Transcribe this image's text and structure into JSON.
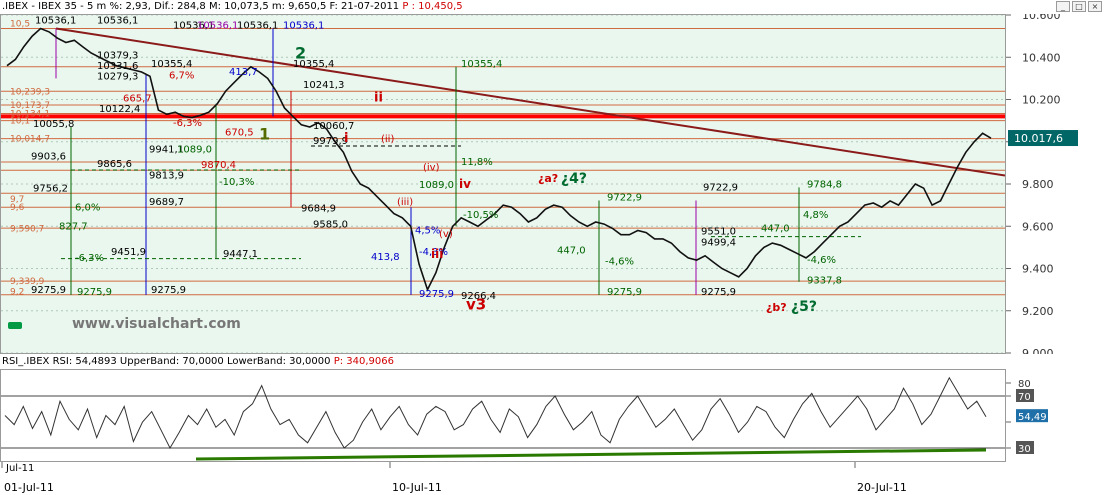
{
  "header": {
    "symbol": ".IBEX - IBEX 35 - 5 m",
    "dif_label": "Dif.,",
    "pct_label": "%: 2,93",
    "dif_value": "Dif.: 284,8",
    "max_label": "M: 10,073,5",
    "min_label": "m: 9,650,5",
    "date_label": "F: 21-07-2011",
    "last_label": "P : 10,450,5"
  },
  "rsi_header": {
    "label": "RSI_.IBEX RSI: 54,4893",
    "upper": "UpperBand: 70,0000",
    "lower": "LowerBand: 30,0000",
    "p_label": "P: 340,9066"
  },
  "watermark": "www.visualchart.com",
  "colors": {
    "panel_bg": "#eaf7ee",
    "price_line": "#111111",
    "trend_line": "#8b1a1a",
    "resistance": "#ff0000",
    "fib_line": "#d06a40",
    "green": "#006400",
    "blue": "#0000cc",
    "purple": "#9900aa",
    "red_text": "#cc0000",
    "current_price_bg": "#006666"
  },
  "chart_data": [
    {
      "type": "line",
      "title": ".IBEX - IBEX 35 - 5 m",
      "ylim": [
        9000,
        10600
      ],
      "y_ticks": [
        10600,
        10400,
        10200,
        10000,
        9800,
        9600,
        9400,
        9200,
        9000
      ],
      "y_tick_labels": [
        "10.600",
        "10.400",
        "10.200",
        "10.000",
        "9.800",
        "9.600",
        "9.400",
        "9.200",
        "9.000"
      ],
      "current_price": "10.017,6",
      "current_price_value": 10017.6,
      "x_labels": [
        "01-Jul-11",
        "10-Jul-11",
        "20-Jul-11"
      ],
      "series": [
        {
          "values": [
            10360,
            10390,
            10450,
            10500,
            10536,
            10520,
            10490,
            10470,
            10480,
            10450,
            10420,
            10400,
            10380,
            10360,
            10350,
            10340,
            10330,
            10310,
            10150,
            10130,
            10140,
            10120,
            10115,
            10125,
            10140,
            10180,
            10240,
            10280,
            10320,
            10355,
            10330,
            10300,
            10240,
            10160,
            10120,
            10080,
            10070,
            10090,
            10060,
            10000,
            9950,
            9860,
            9800,
            9780,
            9740,
            9700,
            9660,
            9640,
            9600,
            9420,
            9300,
            9380,
            9500,
            9600,
            9640,
            9620,
            9600,
            9630,
            9660,
            9700,
            9690,
            9660,
            9620,
            9640,
            9680,
            9700,
            9690,
            9650,
            9620,
            9600,
            9620,
            9610,
            9590,
            9560,
            9560,
            9580,
            9570,
            9540,
            9540,
            9520,
            9480,
            9450,
            9440,
            9460,
            9430,
            9400,
            9380,
            9360,
            9400,
            9460,
            9500,
            9520,
            9510,
            9490,
            9470,
            9450,
            9480,
            9520,
            9560,
            9600,
            9620,
            9660,
            9700,
            9710,
            9690,
            9720,
            9700,
            9750,
            9800,
            9780,
            9700,
            9720,
            9800,
            9880,
            9950,
            10000,
            10040,
            10017
          ]
        }
      ]
    },
    {
      "type": "line",
      "title": "RSI_.IBEX RSI: 54,4893",
      "ylim": [
        20,
        90
      ],
      "y_ticks": [
        80,
        70,
        50,
        30
      ],
      "y_tick_labels": [
        "80",
        "70",
        "50",
        "30"
      ],
      "current_value": "54,49",
      "upper_band": 70,
      "lower_band": 30,
      "band_labels": [
        "70",
        "30"
      ],
      "x_labels": [
        "Jul-11",
        "10-Jul-11",
        "20-Jul-11"
      ],
      "series": [
        {
          "values": [
            55,
            48,
            62,
            45,
            58,
            40,
            66,
            52,
            44,
            60,
            38,
            55,
            48,
            62,
            35,
            50,
            58,
            44,
            30,
            42,
            55,
            48,
            60,
            46,
            52,
            40,
            58,
            64,
            78,
            60,
            48,
            52,
            40,
            34,
            46,
            58,
            42,
            30,
            36,
            50,
            60,
            44,
            54,
            62,
            48,
            40,
            56,
            62,
            58,
            44,
            48,
            60,
            66,
            52,
            42,
            60,
            54,
            38,
            48,
            62,
            70,
            56,
            44,
            50,
            58,
            40,
            34,
            52,
            62,
            70,
            58,
            46,
            52,
            60,
            48,
            36,
            44,
            60,
            68,
            56,
            42,
            50,
            62,
            58,
            46,
            38,
            52,
            64,
            72,
            58,
            46,
            54,
            62,
            70,
            60,
            44,
            52,
            60,
            76,
            64,
            48,
            56,
            70,
            84,
            72,
            60,
            66,
            54
          ]
        }
      ]
    }
  ],
  "annotations": {
    "price_labels": [
      {
        "text": "10536,1",
        "c": "blk"
      },
      {
        "text": "10536,1",
        "c": "blk"
      },
      {
        "text": "10536,1",
        "c": "blk"
      },
      {
        "text": "10536,1",
        "c": "purple"
      },
      {
        "text": "10536,1",
        "c": "blk"
      },
      {
        "text": "10536,1",
        "c": "blue"
      },
      {
        "text": "10379,3",
        "c": "blk"
      },
      {
        "text": "10355,4",
        "c": "blk"
      },
      {
        "text": "10331,6",
        "c": "blk"
      },
      {
        "text": "10279,3",
        "c": "blk"
      },
      {
        "text": "413,7",
        "c": "blue"
      },
      {
        "text": "6,7%",
        "c": "red"
      },
      {
        "text": "10122,4",
        "c": "blk"
      },
      {
        "text": "665,7",
        "c": "red"
      },
      {
        "text": "-6,3%",
        "c": "red"
      },
      {
        "text": "10055,8",
        "c": "blk"
      },
      {
        "text": "9941,1",
        "c": "blk"
      },
      {
        "text": "1089,0",
        "c": "green"
      },
      {
        "text": "9903,6",
        "c": "blk"
      },
      {
        "text": "9865,6",
        "c": "blk"
      },
      {
        "text": "9870,4",
        "c": "red"
      },
      {
        "text": "9813,9",
        "c": "blk"
      },
      {
        "text": "-10,3%",
        "c": "green"
      },
      {
        "text": "9756,2",
        "c": "blk"
      },
      {
        "text": "9689,7",
        "c": "blk"
      },
      {
        "text": "6,0%",
        "c": "green"
      },
      {
        "text": "827,7",
        "c": "green"
      },
      {
        "text": "9451,9",
        "c": "blk"
      },
      {
        "text": "-6,3%",
        "c": "green"
      },
      {
        "text": "9447,1",
        "c": "blk"
      },
      {
        "text": "9275,9",
        "c": "blk"
      },
      {
        "text": "9275,9",
        "c": "green"
      },
      {
        "text": "9275,9",
        "c": "blk"
      },
      {
        "text": "10355,4",
        "c": "blk"
      },
      {
        "text": "10241,3",
        "c": "blk"
      },
      {
        "text": "10060,7",
        "c": "blk"
      },
      {
        "text": "9979,9",
        "c": "blk"
      },
      {
        "text": "9684,9",
        "c": "blk"
      },
      {
        "text": "9585,0",
        "c": "blk"
      },
      {
        "text": "413,8",
        "c": "blue"
      },
      {
        "text": "4,5%",
        "c": "blue"
      },
      {
        "text": "-4,3%",
        "c": "blue"
      },
      {
        "text": "9275,9",
        "c": "blue"
      },
      {
        "text": "10355,4",
        "c": "green"
      },
      {
        "text": "11,8%",
        "c": "green"
      },
      {
        "text": "1089,0",
        "c": "green"
      },
      {
        "text": "-10,5%",
        "c": "green"
      },
      {
        "text": "9266,4",
        "c": "blk"
      },
      {
        "text": "9722,9",
        "c": "green"
      },
      {
        "text": "447,0",
        "c": "green"
      },
      {
        "text": "-4,6%",
        "c": "green"
      },
      {
        "text": "9275,9",
        "c": "green"
      },
      {
        "text": "9722,9",
        "c": "blk"
      },
      {
        "text": "9551,0",
        "c": "blk"
      },
      {
        "text": "9499,4",
        "c": "blk"
      },
      {
        "text": "9275,9",
        "c": "blk"
      },
      {
        "text": "9784,8",
        "c": "green"
      },
      {
        "text": "4,8%",
        "c": "green"
      },
      {
        "text": "447,0",
        "c": "green"
      },
      {
        "text": "-4,6%",
        "c": "green"
      },
      {
        "text": "9337,8",
        "c": "green"
      },
      {
        "text": "670,5",
        "c": "red"
      }
    ],
    "left_edge_labels": [
      "10,5",
      "10,239,3",
      "10,173,7",
      "10,134,1",
      "10,1",
      "10,014,7",
      "9,7",
      "9,6",
      "9,590,7",
      "9,339,9",
      "9,2"
    ],
    "waves": {
      "w1": "1",
      "w2": "2",
      "w3": "v3",
      "w4": "¿4?",
      "w5": "¿5?",
      "wi": "i",
      "wii": "ii",
      "wiii": "iii",
      "wiv": "iv",
      "sub_ii": "(ii)",
      "sub_iv": "(iv)",
      "sub_iii": "(iii)",
      "sub_v": "(v)",
      "wa": "¿a?",
      "wb": "¿b?"
    },
    "fib_levels": [
      10536,
      10355,
      10239,
      10174,
      10134,
      10100,
      10015,
      9904,
      9865,
      9756,
      9690,
      9591,
      9340,
      9276
    ]
  }
}
